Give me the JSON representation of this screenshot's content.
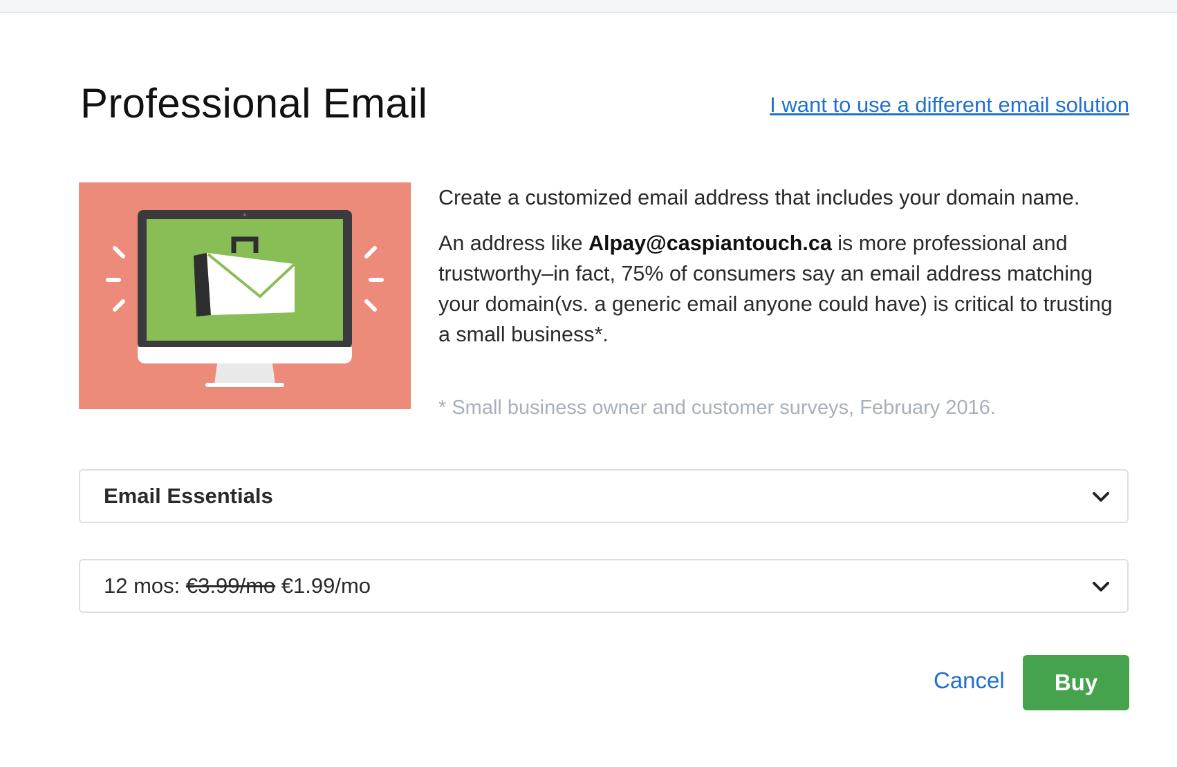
{
  "dialog": {
    "title": "Professional Email",
    "alt_link": "I want to use a different email solution"
  },
  "hero": {
    "illustration": "monitor-with-envelope-briefcase",
    "background_color": "#ec8b79",
    "screen_color": "#88be55"
  },
  "description": {
    "intro": "Create a customized email address that includes your domain name.",
    "pitch_prefix": "An address like ",
    "example_address": "Alpay@caspiantouch.ca",
    "pitch_suffix": " is more professional and trustworthy–in fact, 75% of consumers say an email address matching your domain(vs. a generic email anyone could have) is critical to trusting a small business*.",
    "footnote": "* Small business owner and customer surveys, February 2016."
  },
  "plan_select": {
    "value": "Email Essentials",
    "icon": "chevron-down-icon"
  },
  "term_select": {
    "term": "12 mos:",
    "old_price": "€3.99/mo",
    "new_price": "€1.99/mo",
    "icon": "chevron-down-icon"
  },
  "actions": {
    "cancel_label": "Cancel",
    "buy_label": "Buy",
    "buy_color": "#45a34d",
    "link_color": "#1f6fd0"
  }
}
